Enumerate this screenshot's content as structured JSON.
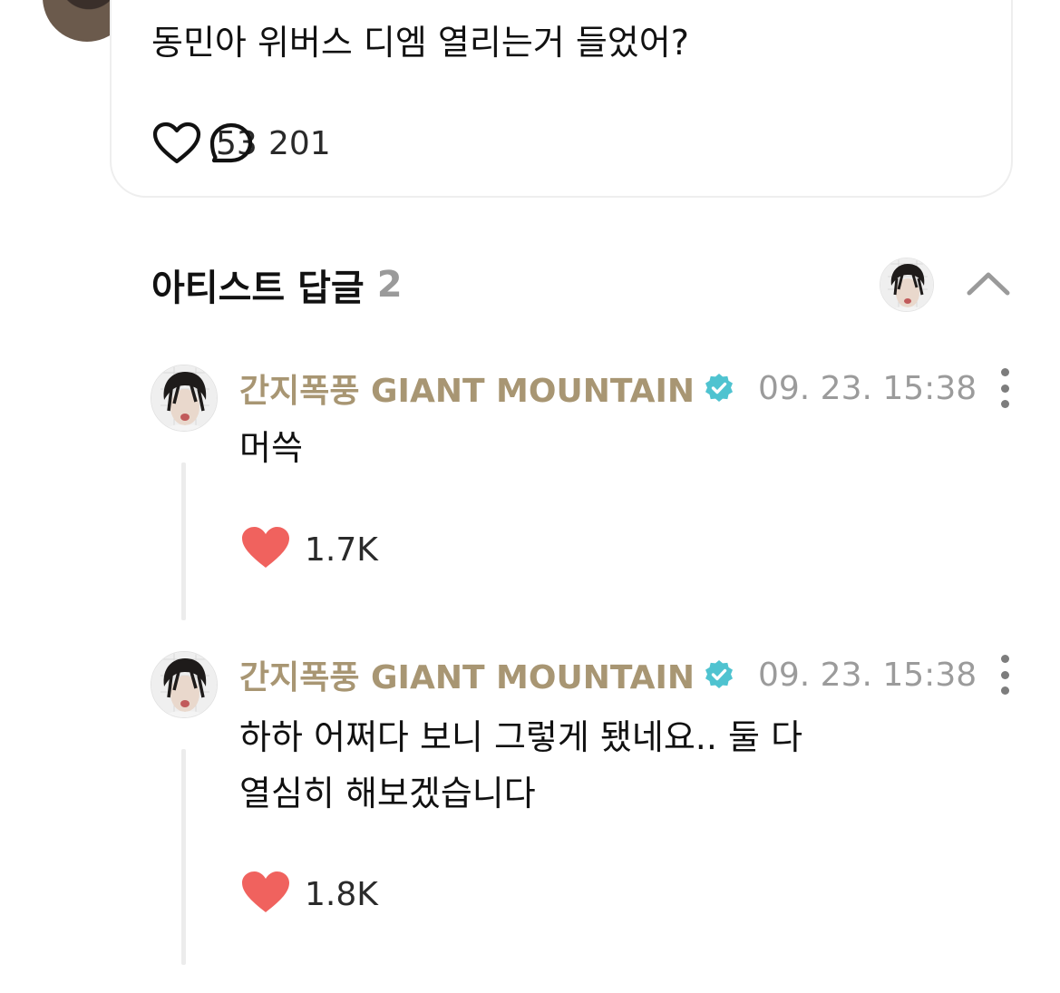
{
  "post": {
    "text": "동민아 위버스 디엠 열리는거 들었어?",
    "likes": "53",
    "comments": "201"
  },
  "replies_section": {
    "title": "아티스트 답글",
    "count": "2"
  },
  "comments": [
    {
      "author": "간지폭풍 GIANT MOUNTAIN",
      "timestamp": "09. 23. 15:38",
      "body_lines": [
        "머쓱"
      ],
      "likes": "1.7K"
    },
    {
      "author": "간지폭풍 GIANT MOUNTAIN",
      "timestamp": "09. 23. 15:38",
      "body_lines": [
        "하하 어쩌다 보니 그렇게 됐네요.. 둘 다",
        "열심히 해보겠습니다"
      ],
      "likes": "1.8K"
    }
  ],
  "colors": {
    "author": "#a89673",
    "verified": "#4fc3d0",
    "liked_heart": "#f0625e",
    "timestamp": "#9b9b9b",
    "count_gray": "#9a9a9a"
  },
  "icons": {
    "like": "heart-outline-icon",
    "comment": "speech-bubble-icon",
    "collapse": "chevron-up-icon",
    "verified": "verified-badge-icon",
    "more": "more-vertical-icon",
    "liked": "heart-filled-icon"
  }
}
